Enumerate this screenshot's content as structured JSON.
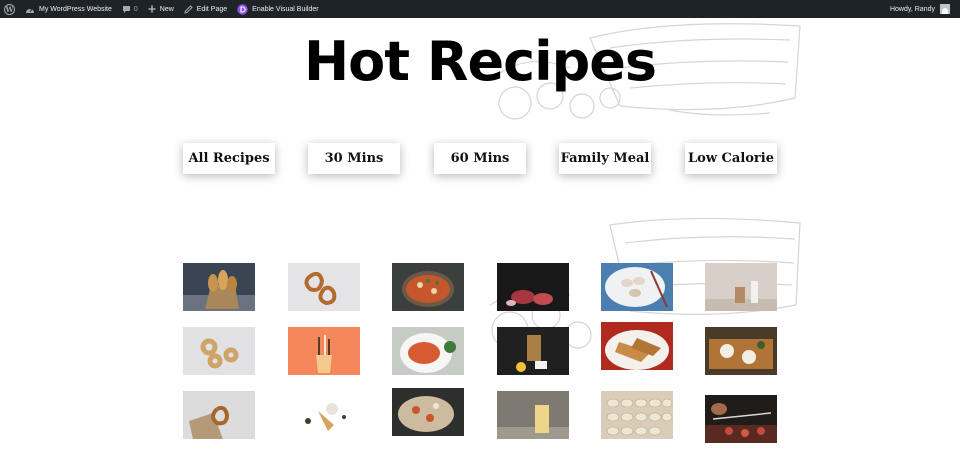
{
  "admin_bar": {
    "site_name": "My WordPress Website",
    "comments_count": "0",
    "new_label": "New",
    "edit_page_label": "Edit Page",
    "visual_builder_label": "Enable Visual Builder",
    "greeting": "Howdy, Randy",
    "icons": [
      "wordpress-logo-icon",
      "dashboard-icon",
      "comment-icon",
      "plus-icon",
      "pencil-icon",
      "divi-icon",
      "avatar"
    ]
  },
  "page": {
    "title": "Hot Recipes",
    "filters": [
      "All Recipes",
      "30 Mins",
      "60 Mins",
      "Family Meal",
      "Low Calorie"
    ]
  },
  "gallery": {
    "rows": 3,
    "columns": 6,
    "items": [
      "bread-rolls-in-bag",
      "pretzels",
      "pizza-on-board",
      "raw-meat-cuts",
      "dumplings-plate",
      "cookies-and-milk",
      "bagels",
      "ice-cream-cups",
      "pasta-dish",
      "drink-and-lemon",
      "chicken-plate",
      "desserts-board",
      "pretzel-on-paper",
      "ice-cream-cones",
      "pizza-slices",
      "lemonade-glass",
      "dumplings-rows",
      "skewers-grill"
    ]
  },
  "colors": {
    "admin_bar_bg": "#1d2327",
    "divi_purple": "#8c53e6",
    "sketch_gray": "#d5d5d5"
  }
}
